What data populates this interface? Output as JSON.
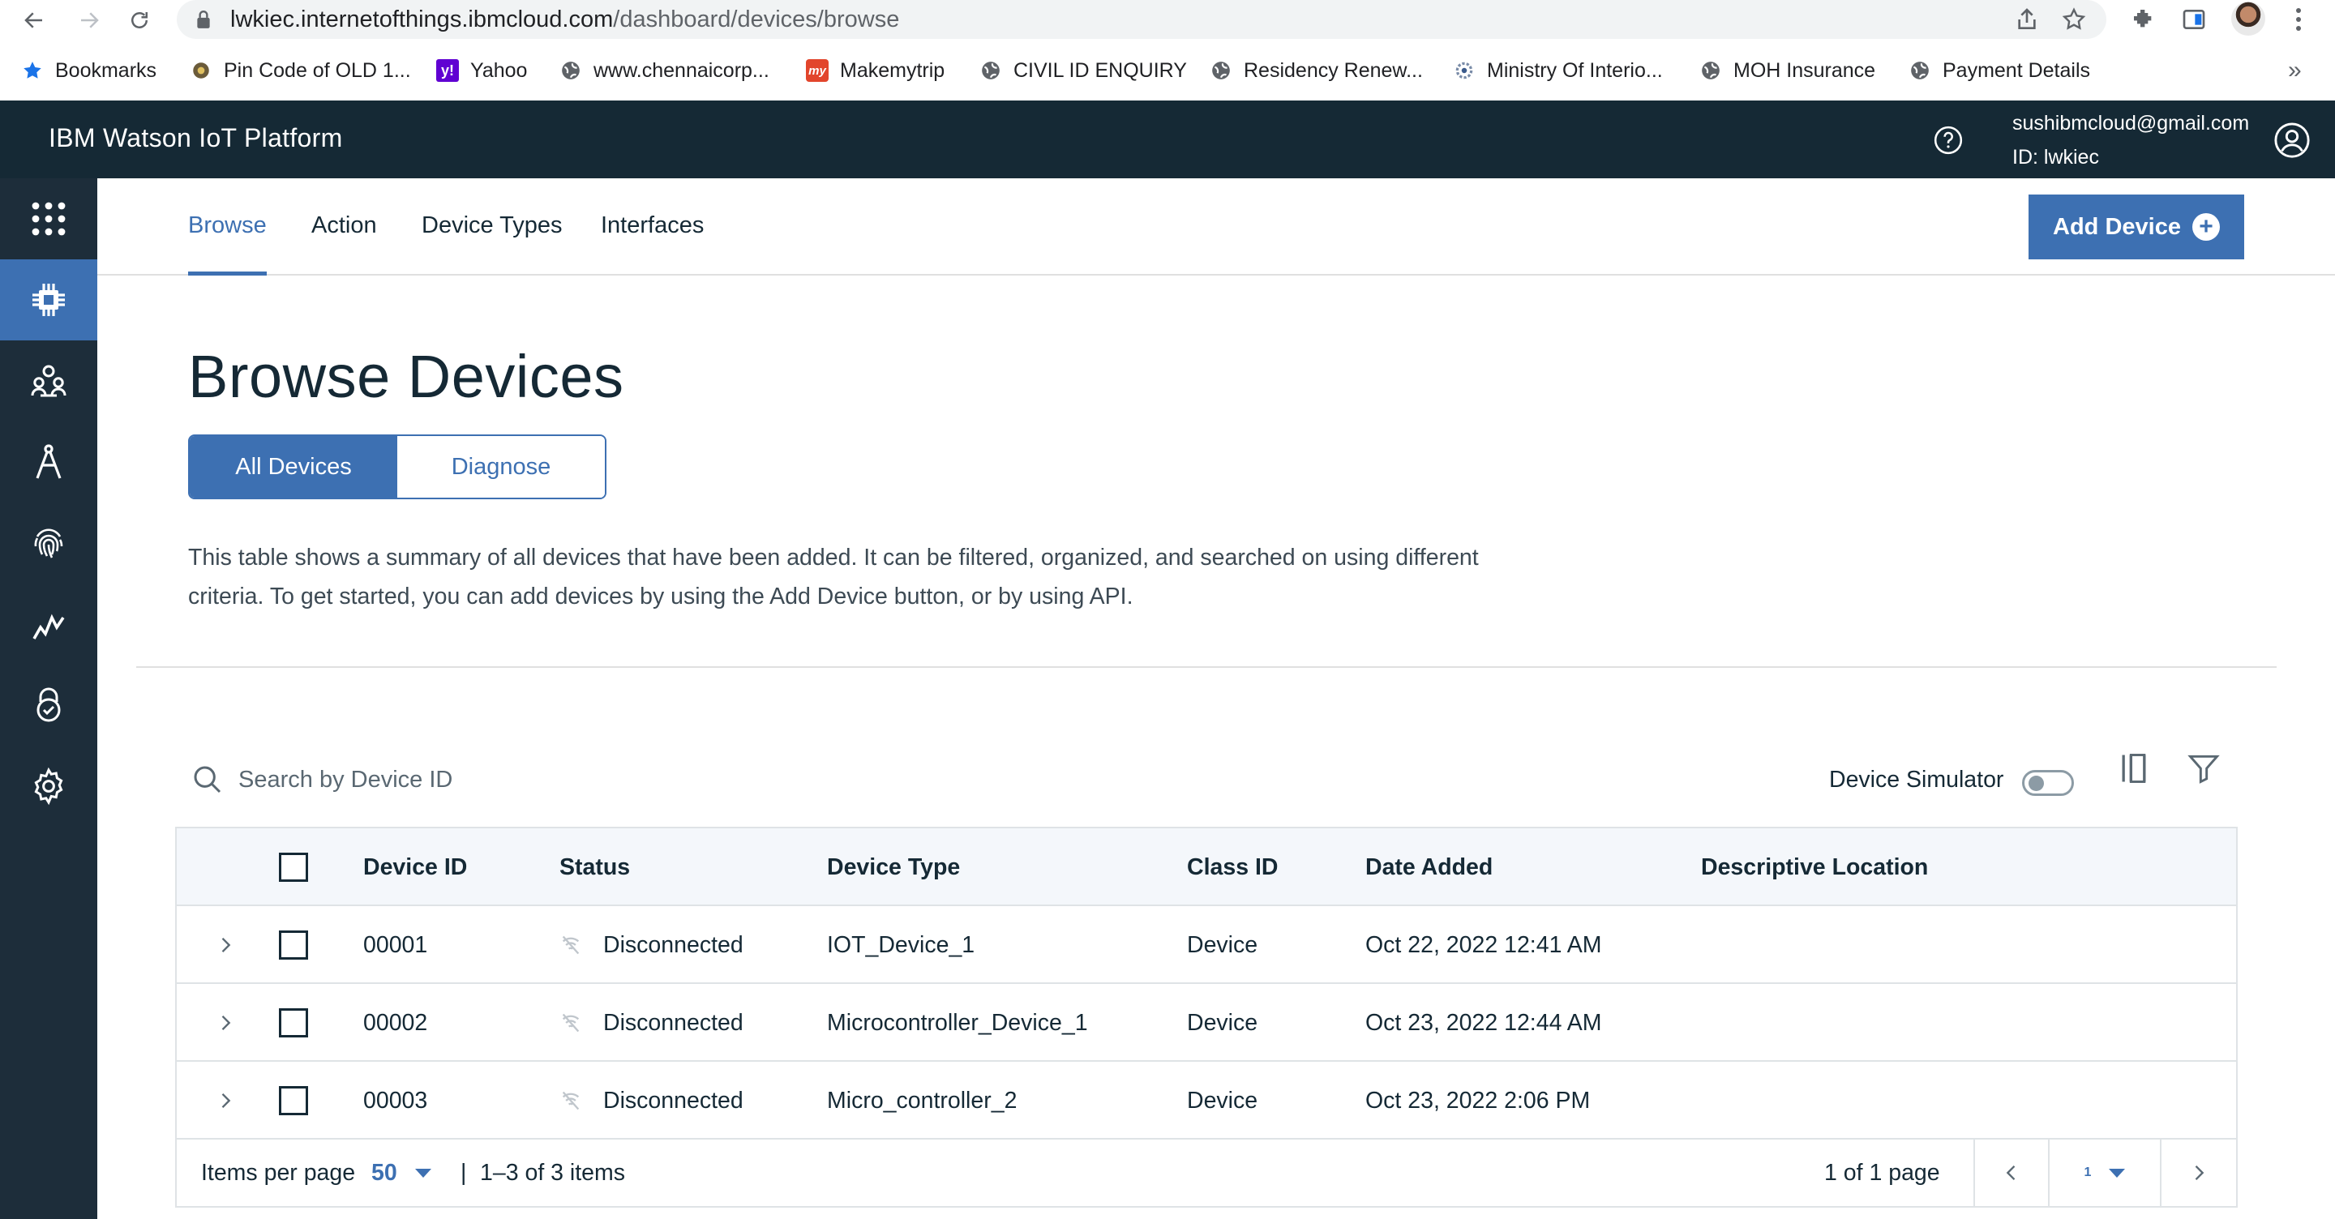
{
  "browser": {
    "url_host": "lwkiec.internetofthings.ibmcloud.com",
    "url_path": "/dashboard/devices/browse",
    "bookmarks": [
      {
        "label": "Bookmarks",
        "icon": "star-icon"
      },
      {
        "label": "Pin Code of OLD 1...",
        "icon": "site-icon"
      },
      {
        "label": "Yahoo",
        "icon": "yahoo-icon"
      },
      {
        "label": "www.chennaicorp...",
        "icon": "globe-icon"
      },
      {
        "label": "Makemytrip",
        "icon": "makemytrip-icon"
      },
      {
        "label": "CIVIL ID ENQUIRY",
        "icon": "globe-icon"
      },
      {
        "label": "Residency Renew...",
        "icon": "globe-icon"
      },
      {
        "label": "Ministry Of Interio...",
        "icon": "emblem-icon"
      },
      {
        "label": "MOH Insurance",
        "icon": "globe-icon"
      },
      {
        "label": "Payment Details",
        "icon": "globe-icon"
      }
    ],
    "more": "»"
  },
  "header": {
    "title": "IBM Watson IoT Platform",
    "email": "sushibmcloud@gmail.com",
    "org_id": "ID: lwkiec"
  },
  "tabs": [
    "Browse",
    "Action",
    "Device Types",
    "Interfaces"
  ],
  "add_device_label": "Add Device",
  "page_title": "Browse Devices",
  "segments": [
    "All Devices",
    "Diagnose"
  ],
  "description": "This table shows a summary of all devices that have been added. It can be filtered, organized, and searched on using different criteria. To get started, you can add devices by using the Add Device button, or by using API.",
  "search": {
    "placeholder": "Search by Device ID"
  },
  "simulator_label": "Device Simulator",
  "table": {
    "headers": [
      "Device ID",
      "Status",
      "Device Type",
      "Class ID",
      "Date Added",
      "Descriptive Location"
    ],
    "rows": [
      {
        "device_id": "00001",
        "status": "Disconnected",
        "device_type": "IOT_Device_1",
        "class_id": "Device",
        "date_added": "Oct 22, 2022 12:41 AM",
        "location": ""
      },
      {
        "device_id": "00002",
        "status": "Disconnected",
        "device_type": "Microcontroller_Device_1",
        "class_id": "Device",
        "date_added": "Oct 23, 2022 12:44 AM",
        "location": ""
      },
      {
        "device_id": "00003",
        "status": "Disconnected",
        "device_type": "Micro_controller_2",
        "class_id": "Device",
        "date_added": "Oct 23, 2022 2:06 PM",
        "location": ""
      }
    ]
  },
  "pagination": {
    "items_per_page_label": "Items per page",
    "items_per_page": "50",
    "separator": "|",
    "range": "1–3 of 3 items",
    "page_info": "1 of 1 page",
    "current_page": "1"
  },
  "colors": {
    "header_bg": "#152935",
    "sidenav_bg": "#1d2d3a",
    "accent": "#3d70b2"
  }
}
